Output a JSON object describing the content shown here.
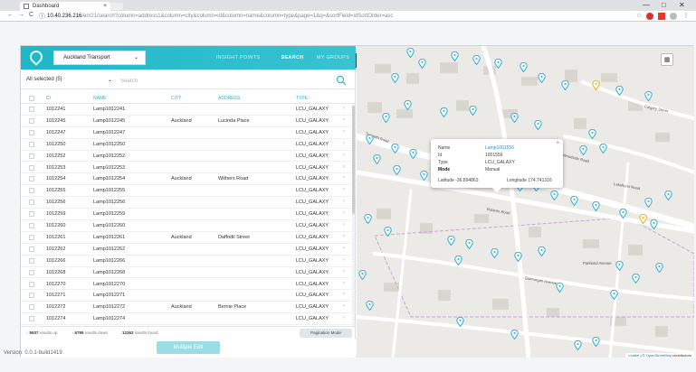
{
  "browser": {
    "tab_title": "Dashboard",
    "tab_close": "×",
    "url_host": "10.40.236.216",
    "url_rest": "/en/21/search?column=address1&column=city&column=id&column=name&column=type&page=1&q=&sortField=idSortOrder=asc",
    "back": "←",
    "forward": "→",
    "reload": "C",
    "info": "ⓘ",
    "minimize": "—",
    "maximize": "□",
    "close": "✕",
    "star": "☆",
    "menu": "⋮"
  },
  "header": {
    "org": "Auckland Transport",
    "tabs": [
      {
        "label": "INSIGHT POINTS",
        "active": false
      },
      {
        "label": "SEARCH",
        "active": true
      },
      {
        "label": "MY GROUPS",
        "active": false
      }
    ],
    "collapse_arrow_1": "›",
    "collapse_arrow_2": "‹"
  },
  "filter": {
    "selection": "All selected (5)",
    "placeholder": "Search"
  },
  "table": {
    "columns": [
      "ID",
      "NAME",
      "CITY",
      "ADDRESS",
      "TYPE"
    ],
    "rows": [
      {
        "id": "1012241",
        "name": "Lamp1012241",
        "city": "",
        "address": "",
        "type": "LCU_GALAXY"
      },
      {
        "id": "1012245",
        "name": "Lamp1012245",
        "city": "Auckland",
        "address": "Lucinda Place",
        "type": "LCU_GALAXY"
      },
      {
        "id": "1012247",
        "name": "Lamp1012247",
        "city": "",
        "address": "",
        "type": "LCU_GALAXY"
      },
      {
        "id": "1012250",
        "name": "Lamp1012250",
        "city": "",
        "address": "",
        "type": "LCU_GALAXY"
      },
      {
        "id": "1012252",
        "name": "Lamp1012252",
        "city": "",
        "address": "",
        "type": "LCU_GALAXY"
      },
      {
        "id": "1012253",
        "name": "Lamp1012253",
        "city": "",
        "address": "",
        "type": "LCU_GALAXY"
      },
      {
        "id": "1012254",
        "name": "Lamp1012254",
        "city": "Auckland",
        "address": "Withers Road",
        "type": "LCU_GALAXY"
      },
      {
        "id": "1012255",
        "name": "Lamp1012255",
        "city": "",
        "address": "",
        "type": "LCU_GALAXY"
      },
      {
        "id": "1012256",
        "name": "Lamp1012256",
        "city": "",
        "address": "",
        "type": "LCU_GALAXY"
      },
      {
        "id": "1012259",
        "name": "Lamp1012259",
        "city": "",
        "address": "",
        "type": "LCU_GALAXY"
      },
      {
        "id": "1012260",
        "name": "Lamp1012260",
        "city": "",
        "address": "",
        "type": "LCU_GALAXY"
      },
      {
        "id": "1012261",
        "name": "Lamp1012261",
        "city": "Auckland",
        "address": "Daffodil Street",
        "type": "LCU_GALAXY"
      },
      {
        "id": "1012262",
        "name": "Lamp1012262",
        "city": "",
        "address": "",
        "type": "LCU_GALAXY"
      },
      {
        "id": "1012266",
        "name": "Lamp1012266",
        "city": "",
        "address": "",
        "type": "LCU_GALAXY"
      },
      {
        "id": "1012268",
        "name": "Lamp1012268",
        "city": "",
        "address": "",
        "type": "LCU_GALAXY"
      },
      {
        "id": "1012270",
        "name": "Lamp1012270",
        "city": "",
        "address": "",
        "type": "LCU_GALAXY"
      },
      {
        "id": "1012271",
        "name": "Lamp1012271",
        "city": "",
        "address": "",
        "type": "LCU_GALAXY"
      },
      {
        "id": "1012272",
        "name": "Lamp1012272",
        "city": "Auckland",
        "address": "Bernie Place",
        "type": "LCU_GALAXY"
      },
      {
        "id": "1012274",
        "name": "Lamp1012274",
        "city": "",
        "address": "",
        "type": "LCU_GALAXY"
      }
    ]
  },
  "footer": {
    "up_count": "5937",
    "up_label": "results up",
    "down_count": "6795",
    "down_label": "results down",
    "found_count": "12262",
    "found_label": "results found",
    "pagination": "Pagination Mode",
    "multi_edit": "Multiple Edit"
  },
  "version": "Version: 0.0.1-build1419",
  "popup": {
    "name_label": "Name",
    "name_value": "Lamp1001556",
    "id_label": "Id",
    "id_value": "1001556",
    "type_label": "Type",
    "type_value": "LCU_GALAXY",
    "mode_label": "Mode",
    "mode_value": "Manual",
    "lat_label": "Latitude",
    "lat_value": "-36.894863",
    "lng_label": "Longitude",
    "lng_value": "174.741316",
    "close": "×"
  },
  "map": {
    "layers_icon": "▦",
    "attribution_leaflet": "Leaflet",
    "attribution_sep": " | © ",
    "attribution_osm": "OpenStreetMap",
    "attribution_tail": " contributors",
    "streets": [
      {
        "label": "Calgary Street"
      },
      {
        "label": "Trenwith Road"
      },
      {
        "label": "Woodside Road"
      },
      {
        "label": "Lakehurst Road"
      },
      {
        "label": "Roberts Road"
      },
      {
        "label": "Glamorgan Avenue"
      },
      {
        "label": "Parkland Avenue"
      }
    ]
  },
  "colors": {
    "accent": "#1fb7c9",
    "pin": "#45b9db",
    "pin_selected": "#f2b631"
  }
}
